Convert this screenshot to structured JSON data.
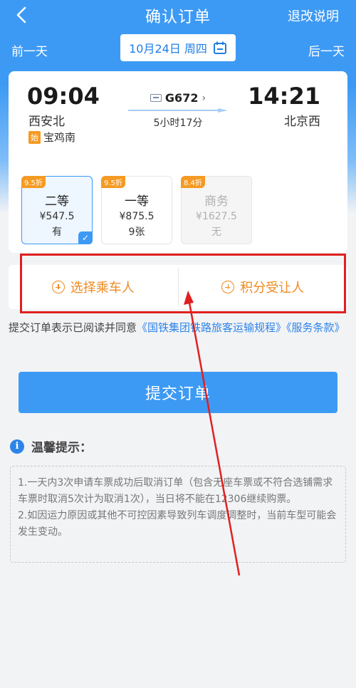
{
  "header": {
    "title": "确认订单",
    "refund_link": "退改说明"
  },
  "date_bar": {
    "prev_day": "前一天",
    "next_day": "后一天",
    "date": "10月24日 周四"
  },
  "trip": {
    "departure_time": "09:04",
    "departure_station": "西安北",
    "origin_badge": "始",
    "origin_station": "宝鸡南",
    "train_no": "G672",
    "duration": "5小时17分",
    "arrival_time": "14:21",
    "arrival_station": "北京西"
  },
  "seats": [
    {
      "discount": "9.5折",
      "name": "二等",
      "price": "¥547.5",
      "stock": "有",
      "selected": true
    },
    {
      "discount": "9.5折",
      "name": "一等",
      "price": "¥875.5",
      "stock": "9张",
      "selected": false
    },
    {
      "discount": "8.4折",
      "name": "商务",
      "price": "¥1627.5",
      "stock": "无",
      "selected": false
    }
  ],
  "actions": {
    "select_passenger": "选择乘车人",
    "points_recipient": "积分受让人"
  },
  "agreement": {
    "prefix": "提交订单表示已阅读并同意",
    "link1": "《国铁集团铁路旅客运输规程》",
    "link2": "《服务条款》"
  },
  "submit_label": "提交订单",
  "tips": {
    "title": "温馨提示：",
    "item1": "1.一天内3次申请车票成功后取消订单（包含无座车票或不符合选铺需求车票时取消5次计为取消1次），当日将不能在12306继续购票。",
    "item2": "2.如因运力原因或其他不可控因素导致列车调度调整时，当前车型可能会发生变动。"
  },
  "colors": {
    "primary": "#3d9af4",
    "accent": "#ef8a1e",
    "discount": "#f59a23",
    "annotation": "#e02020"
  }
}
